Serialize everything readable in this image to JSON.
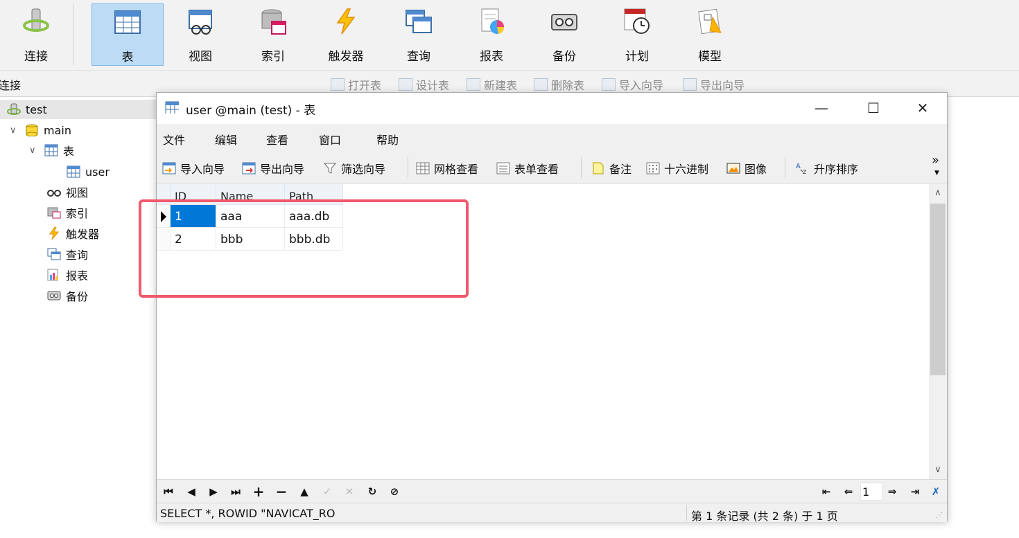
{
  "toolbar": {
    "items": [
      {
        "label": "连接",
        "icon": "connect-icon"
      },
      {
        "label": "表",
        "icon": "table-icon"
      },
      {
        "label": "视图",
        "icon": "view-icon"
      },
      {
        "label": "索引",
        "icon": "index-icon"
      },
      {
        "label": "触发器",
        "icon": "trigger-icon"
      },
      {
        "label": "查询",
        "icon": "query-icon"
      },
      {
        "label": "报表",
        "icon": "report-icon"
      },
      {
        "label": "备份",
        "icon": "backup-icon"
      },
      {
        "label": "计划",
        "icon": "schedule-icon"
      },
      {
        "label": "模型",
        "icon": "model-icon"
      }
    ],
    "active": "表"
  },
  "subbar": {
    "left_label": "连接",
    "buttons": [
      "打开表",
      "设计表",
      "新建表",
      "删除表",
      "导入向导",
      "导出向导"
    ]
  },
  "tree": {
    "connection": "test",
    "database": "main",
    "tables_node": "表",
    "table": "user",
    "views": "视图",
    "indexes": "索引",
    "triggers": "触发器",
    "queries": "查询",
    "reports": "报表",
    "backups": "备份"
  },
  "window": {
    "title": "user @main (test) - 表",
    "controls": {
      "minimize": "—",
      "maximize": "☐",
      "close": "✕"
    },
    "menu": [
      "文件",
      "编辑",
      "查看",
      "窗口",
      "帮助"
    ],
    "toolbar": {
      "import": "导入向导",
      "export": "导出向导",
      "filter": "筛选向导",
      "grid_view": "网格查看",
      "form_view": "表单查看",
      "memo": "备注",
      "hex": "十六进制",
      "image": "图像",
      "sort": "升序排序",
      "more": "»"
    },
    "grid": {
      "columns": [
        "ID",
        "Name",
        "Path"
      ],
      "rows": [
        [
          "1",
          "aaa",
          "aaa.db"
        ],
        [
          "2",
          "bbb",
          "bbb.db"
        ]
      ]
    },
    "page_number": "1",
    "status": {
      "sql": "SELECT *,  ROWID  \"NAVICAT_RO",
      "records": "第 1 条记录 (共 2 条) 于 1 页"
    }
  },
  "colors": {
    "highlight": "#f0596d",
    "selection": "#0078d7",
    "active_tab": "#bcdcf5"
  }
}
